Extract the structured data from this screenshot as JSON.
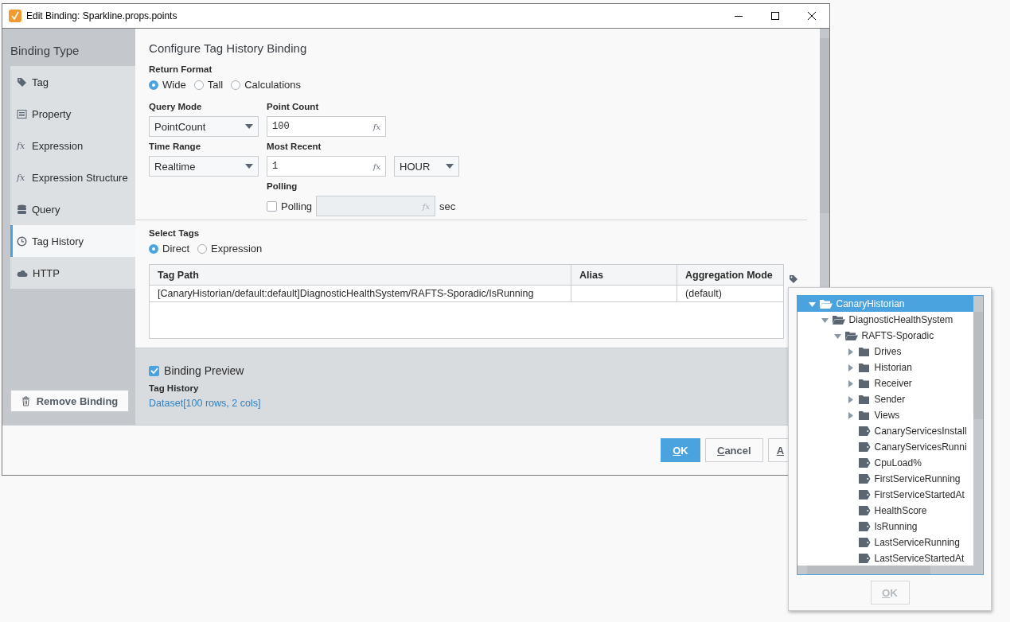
{
  "window": {
    "title": "Edit Binding: Sparkline.props.points"
  },
  "sidebar": {
    "heading": "Binding Type",
    "items": [
      {
        "label": "Tag",
        "kind": "tag",
        "selected": false
      },
      {
        "label": "Property",
        "kind": "property",
        "selected": false
      },
      {
        "label": "Expression",
        "kind": "expression",
        "icon_text": "fx",
        "selected": false
      },
      {
        "label": "Expression Structure",
        "kind": "expression",
        "icon_text": "fx",
        "selected": false
      },
      {
        "label": "Query",
        "kind": "query",
        "selected": false
      },
      {
        "label": "Tag History",
        "kind": "history",
        "selected": true
      },
      {
        "label": "HTTP",
        "kind": "http",
        "selected": false
      }
    ],
    "remove_button": "Remove Binding"
  },
  "content": {
    "heading": "Configure Tag History Binding",
    "return_format": {
      "label": "Return Format",
      "options": [
        {
          "label": "Wide",
          "selected": true
        },
        {
          "label": "Tall",
          "selected": false
        },
        {
          "label": "Calculations",
          "selected": false
        }
      ]
    },
    "query_mode": {
      "label": "Query Mode",
      "value": "PointCount"
    },
    "point_count": {
      "label": "Point Count",
      "value": "100",
      "fx": "fx"
    },
    "time_range": {
      "label": "Time Range",
      "value": "Realtime"
    },
    "most_recent": {
      "label": "Most Recent",
      "value": "1",
      "fx": "fx",
      "unit": "HOUR"
    },
    "polling": {
      "label": "Polling",
      "checkbox": {
        "label": "Polling",
        "checked": false
      },
      "fx": "fx",
      "disabled": true,
      "suffix": "sec"
    },
    "select_tags": {
      "label": "Select Tags",
      "options": [
        {
          "label": "Direct",
          "selected": true
        },
        {
          "label": "Expression",
          "selected": false
        }
      ]
    },
    "table": {
      "columns": [
        "Tag Path",
        "Alias",
        "Aggregation Mode"
      ],
      "rows": [
        [
          "[CanaryHistorian/default:default]DiagnosticHealthSystem/RAFTS-Sporadic/IsRunning",
          "",
          "(default)"
        ]
      ]
    },
    "preview": {
      "label": "Binding Preview",
      "checked": true,
      "section": "Tag History",
      "value": "Dataset[100 rows, 2 cols]"
    }
  },
  "buttons": [
    {
      "label": "OK",
      "primary": true
    },
    {
      "label": "Cancel",
      "primary": false
    },
    {
      "label": "A",
      "primary": false
    }
  ],
  "tag_browser": {
    "tree": [
      {
        "label": "CanaryHistorian",
        "kind": "folder",
        "expanded": true,
        "selected": true,
        "children": [
          {
            "label": "DiagnosticHealthSystem",
            "kind": "folder",
            "expanded": true,
            "selected": false,
            "children": [
              {
                "label": "RAFTS-Sporadic",
                "kind": "folder",
                "expanded": true,
                "selected": false,
                "children": [
                  {
                    "label": "Drives",
                    "kind": "folder",
                    "expanded": false,
                    "selected": false
                  },
                  {
                    "label": "Historian",
                    "kind": "folder",
                    "expanded": false,
                    "selected": false
                  },
                  {
                    "label": "Receiver",
                    "kind": "folder",
                    "expanded": false,
                    "selected": false
                  },
                  {
                    "label": "Sender",
                    "kind": "folder",
                    "expanded": false,
                    "selected": false
                  },
                  {
                    "label": "Views",
                    "kind": "folder",
                    "expanded": false,
                    "selected": false
                  },
                  {
                    "label": "CanaryServicesInstall",
                    "kind": "tag",
                    "selected": false
                  },
                  {
                    "label": "CanaryServicesRunni",
                    "kind": "tag",
                    "selected": false
                  },
                  {
                    "label": "CpuLoad%",
                    "kind": "tag",
                    "selected": false
                  },
                  {
                    "label": "FirstServiceRunning",
                    "kind": "tag",
                    "selected": false
                  },
                  {
                    "label": "FirstServiceStartedAt",
                    "kind": "tag",
                    "selected": false
                  },
                  {
                    "label": "HealthScore",
                    "kind": "tag",
                    "selected": false
                  },
                  {
                    "label": "IsRunning",
                    "kind": "tag",
                    "selected": false
                  },
                  {
                    "label": "LastServiceRunning",
                    "kind": "tag",
                    "selected": false
                  },
                  {
                    "label": "LastServiceStartedAt",
                    "kind": "tag",
                    "selected": false
                  }
                ]
              }
            ]
          }
        ]
      }
    ],
    "ok_button": {
      "label": "OK",
      "disabled": true
    }
  }
}
